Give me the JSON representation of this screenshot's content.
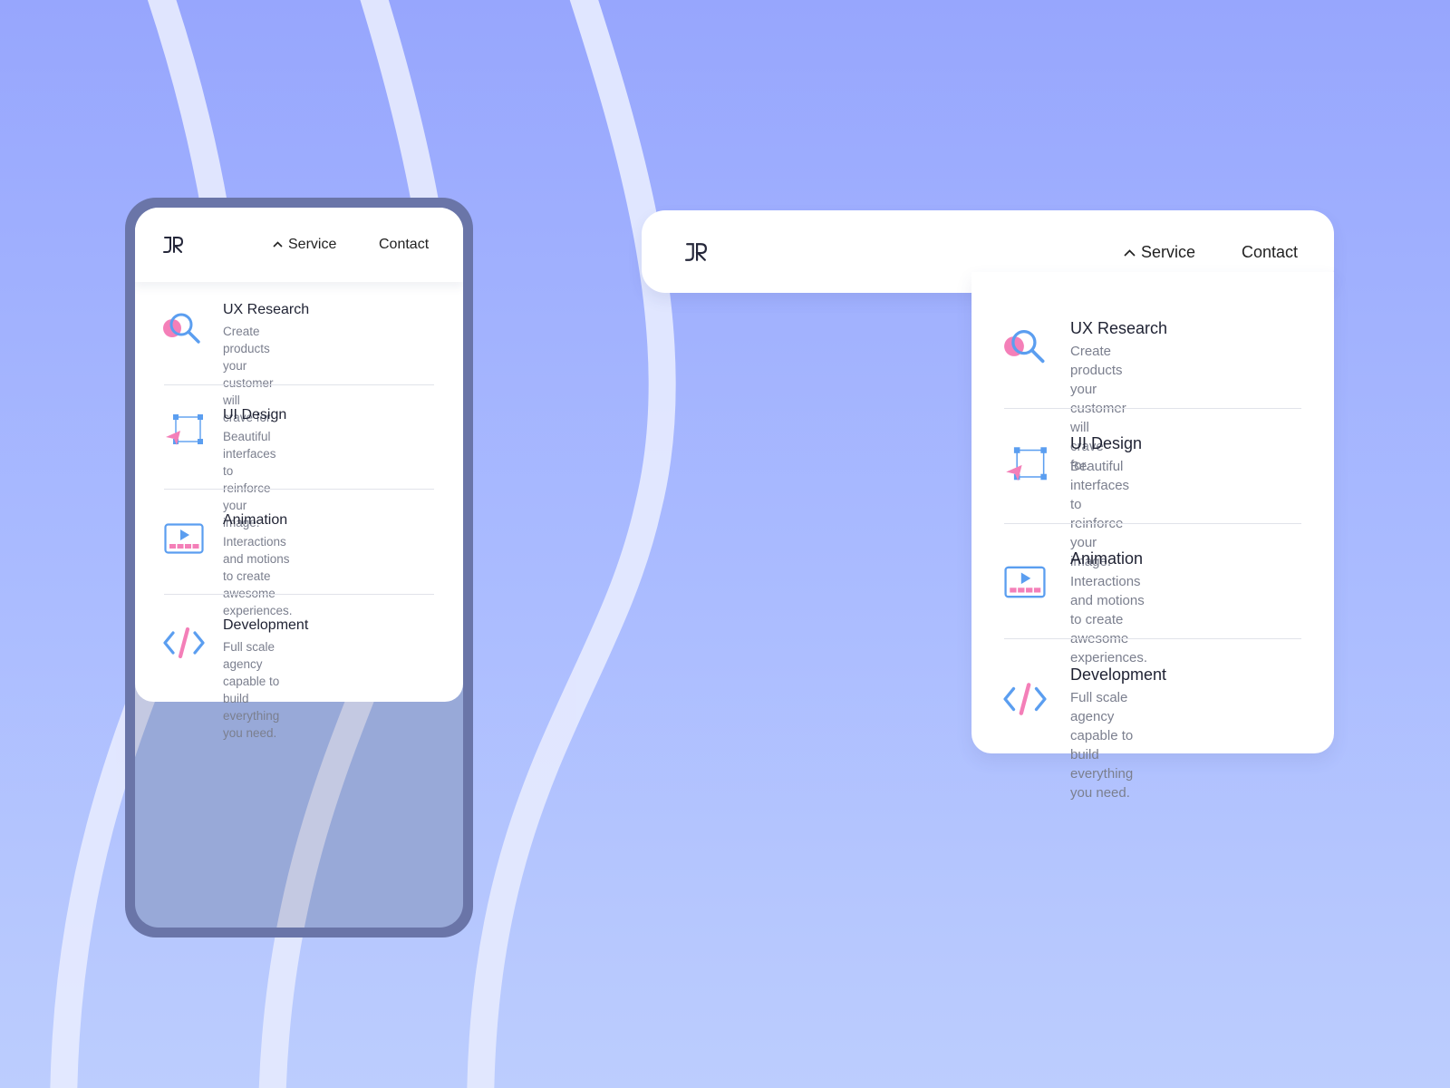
{
  "brand": {
    "logo_text": "JR"
  },
  "nav": {
    "service_label": "Service",
    "contact_label": "Contact"
  },
  "services": [
    {
      "title": "UX Research",
      "desc_line1": "Create products your customer will",
      "desc_line2": "crave for.",
      "icon": "magnifier-icon"
    },
    {
      "title": "UI Design",
      "desc_line1": "Beautiful interfaces to reinforce",
      "desc_line2": "your image.",
      "icon": "vector-select-icon"
    },
    {
      "title": "Animation",
      "desc_line1": "Interactions and motions to create",
      "desc_line2": "awesome experiences.",
      "icon": "video-player-icon"
    },
    {
      "title": "Development",
      "desc_line1": "Full scale agency capable to build",
      "desc_line2": "everything you need.",
      "icon": "code-icon"
    }
  ],
  "colors": {
    "background_top": "#97a6fd",
    "background_bottom": "#bccdfe",
    "icon_blue": "#5b9ef0",
    "icon_pink": "#f47fb8",
    "phone_frame": "#6a75a8"
  }
}
